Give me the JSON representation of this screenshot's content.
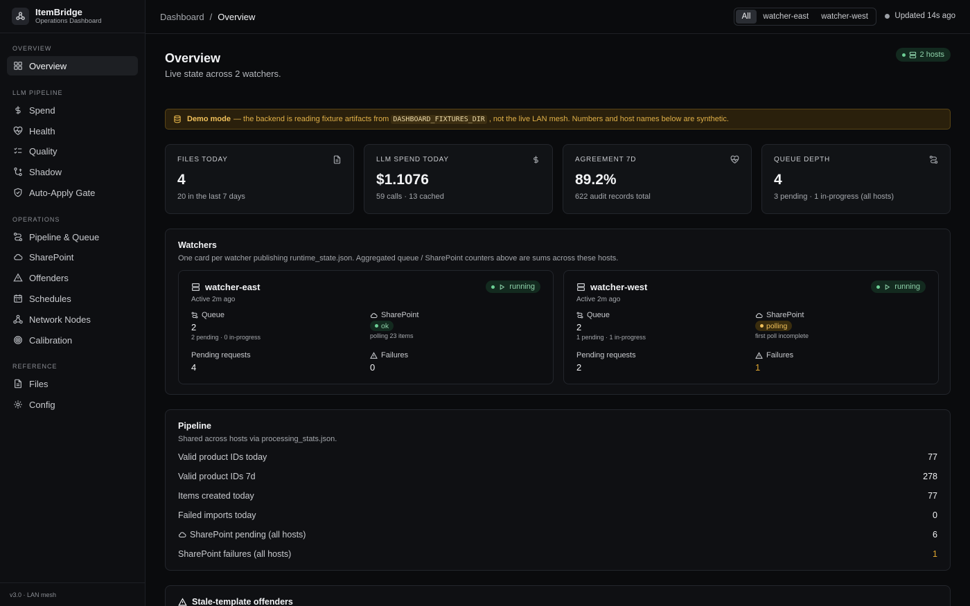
{
  "brand": {
    "name": "ItemBridge",
    "subtitle": "Operations Dashboard"
  },
  "sidebar": {
    "sections": [
      {
        "label": "OVERVIEW",
        "items": [
          {
            "label": "Overview",
            "icon": "grid-icon",
            "active": true
          }
        ]
      },
      {
        "label": "LLM PIPELINE",
        "items": [
          {
            "label": "Spend",
            "icon": "dollar-icon"
          },
          {
            "label": "Health",
            "icon": "heart-pulse-icon"
          },
          {
            "label": "Quality",
            "icon": "checklist-icon"
          },
          {
            "label": "Shadow",
            "icon": "branch-icon"
          },
          {
            "label": "Auto-Apply Gate",
            "icon": "shield-check-icon"
          }
        ]
      },
      {
        "label": "OPERATIONS",
        "items": [
          {
            "label": "Pipeline & Queue",
            "icon": "route-icon"
          },
          {
            "label": "SharePoint",
            "icon": "cloud-icon"
          },
          {
            "label": "Offenders",
            "icon": "warning-icon"
          },
          {
            "label": "Schedules",
            "icon": "calendar-icon"
          },
          {
            "label": "Network Nodes",
            "icon": "network-icon"
          },
          {
            "label": "Calibration",
            "icon": "target-icon"
          }
        ]
      },
      {
        "label": "REFERENCE",
        "items": [
          {
            "label": "Files",
            "icon": "file-icon"
          },
          {
            "label": "Config",
            "icon": "gear-icon"
          }
        ]
      }
    ],
    "footer": "v3.0 · LAN mesh"
  },
  "topbar": {
    "breadcrumb_root": "Dashboard",
    "breadcrumb_sep": "/",
    "breadcrumb_current": "Overview",
    "host_filter": [
      "All",
      "watcher-east",
      "watcher-west"
    ],
    "host_filter_selected": "All",
    "updated": "Updated 14s ago"
  },
  "page": {
    "title": "Overview",
    "subtitle": "Live state across 2 watchers.",
    "hosts_badge": "2 hosts"
  },
  "demo": {
    "strong": "Demo mode",
    "text_before": "— the backend is reading fixture artifacts from",
    "code": "DASHBOARD_FIXTURES_DIR",
    "text_after": ", not the live LAN mesh. Numbers and host names below are synthetic."
  },
  "kpis": [
    {
      "label": "FILES TODAY",
      "value": "4",
      "sub": "20 in the last 7 days",
      "icon": "file-icon"
    },
    {
      "label": "LLM SPEND TODAY",
      "value": "$1.1076",
      "sub": "59 calls · 13 cached",
      "icon": "dollar-icon"
    },
    {
      "label": "AGREEMENT 7D",
      "value": "89.2%",
      "sub": "622 audit records total",
      "icon": "heart-pulse-icon"
    },
    {
      "label": "QUEUE DEPTH",
      "value": "4",
      "sub": "3 pending · 1 in-progress (all hosts)",
      "icon": "route-icon"
    }
  ],
  "watchers": {
    "title": "Watchers",
    "subtitle": "One card per watcher publishing runtime_state.json. Aggregated queue / SharePoint counters above are sums across these hosts.",
    "cards": [
      {
        "name": "watcher-east",
        "active": "Active 2m ago",
        "status": "running",
        "queue_label": "Queue",
        "queue_value": "2",
        "queue_sub": "2 pending · 0 in-progress",
        "sp_label": "SharePoint",
        "sp_status": "ok",
        "sp_sub": "polling 23 items",
        "pending_label": "Pending requests",
        "pending_value": "4",
        "failures_label": "Failures",
        "failures_value": "0"
      },
      {
        "name": "watcher-west",
        "active": "Active 2m ago",
        "status": "running",
        "queue_label": "Queue",
        "queue_value": "2",
        "queue_sub": "1 pending · 1 in-progress",
        "sp_label": "SharePoint",
        "sp_status": "polling",
        "sp_sub": "first poll incomplete",
        "pending_label": "Pending requests",
        "pending_value": "2",
        "failures_label": "Failures",
        "failures_value": "1"
      }
    ]
  },
  "pipeline": {
    "title": "Pipeline",
    "subtitle": "Shared across hosts via processing_stats.json.",
    "rows": [
      {
        "label": "Valid product IDs today",
        "value": "77"
      },
      {
        "label": "Valid product IDs 7d",
        "value": "278"
      },
      {
        "label": "Items created today",
        "value": "77"
      },
      {
        "label": "Failed imports today",
        "value": "0"
      },
      {
        "label": "SharePoint pending (all hosts)",
        "value": "6"
      },
      {
        "label": "SharePoint failures (all hosts)",
        "value": "1"
      }
    ]
  },
  "offenders": {
    "title": "Stale-template offenders"
  },
  "colors": {
    "accent_green": "#6ccf95",
    "warning_amber": "#e0a730",
    "background": "#0a0b0d"
  }
}
